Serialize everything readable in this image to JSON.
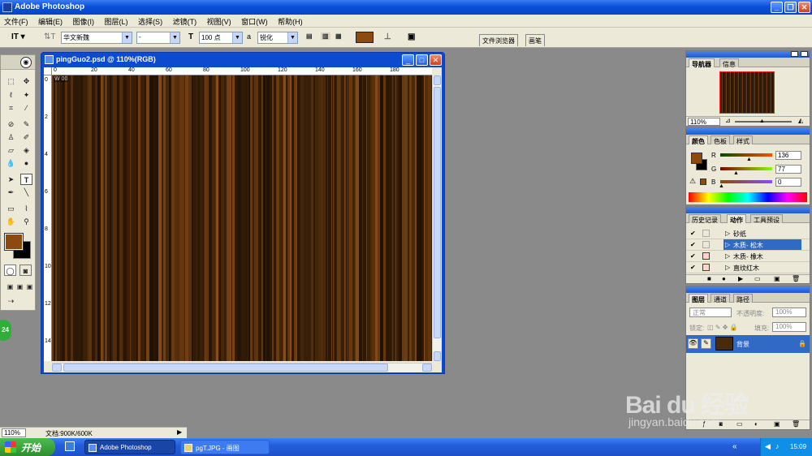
{
  "app": {
    "title": "Adobe Photoshop"
  },
  "menu": [
    "文件(F)",
    "编辑(E)",
    "图像(I)",
    "图层(L)",
    "选择(S)",
    "滤镜(T)",
    "视图(V)",
    "窗口(W)",
    "帮助(H)"
  ],
  "options": {
    "font_family": "华文新魏",
    "font_style": "-",
    "font_size": "100 点",
    "antialias_prefix": "a",
    "antialias": "锐化",
    "color": "#8c4a0e",
    "tabs": [
      "文件浏览器",
      "画笔"
    ]
  },
  "document": {
    "title": "pingGuo2.psd @ 110%(RGB)",
    "ruler_h": [
      "0",
      "20",
      "40",
      "60",
      "80",
      "100",
      "120",
      "140",
      "160",
      "180"
    ],
    "ruler_v": [
      "0",
      "2",
      "4",
      "6",
      "8",
      "10",
      "12",
      "14"
    ],
    "corner_marks": "W 00",
    "canvas_colors": [
      "#3a2008",
      "#6b3a10",
      "#2a1606",
      "#8a4e18",
      "#4a2a0c",
      "#1e1004"
    ]
  },
  "navigator": {
    "tabs": [
      "导航器",
      "信息"
    ],
    "zoom": "110%"
  },
  "color_panel": {
    "tabs": [
      "颜色",
      "色板",
      "样式"
    ],
    "channels": [
      {
        "label": "R",
        "value": "136"
      },
      {
        "label": "G",
        "value": "77"
      },
      {
        "label": "B",
        "value": "0"
      }
    ],
    "foreground": "#8c4a0e",
    "background": "#000000"
  },
  "actions_panel": {
    "tabs": [
      "历史记录",
      "动作",
      "工具预设"
    ],
    "items": [
      "砂纸",
      "木质- 松木",
      "木质- 橡木",
      "直纹红木"
    ],
    "selected_index": 1
  },
  "layers_panel": {
    "tabs": [
      "图层",
      "通道",
      "路径"
    ],
    "blend_mode": "正常",
    "opacity_label": "不透明度:",
    "opacity": "100%",
    "lock_label": "锁定:",
    "fill_label": "填充:",
    "fill": "100%",
    "layer_name": "背景"
  },
  "status": {
    "zoom": "110%",
    "doc_info": "文档:900K/600K"
  },
  "badge": "24",
  "taskbar": {
    "start": "开始",
    "tasks": [
      "Adobe Photoshop",
      "pgT.JPG - 画图"
    ],
    "clock": "15:09"
  },
  "watermark": {
    "brand": "Bai du 经验",
    "url": "jingyan.baidu.com"
  }
}
